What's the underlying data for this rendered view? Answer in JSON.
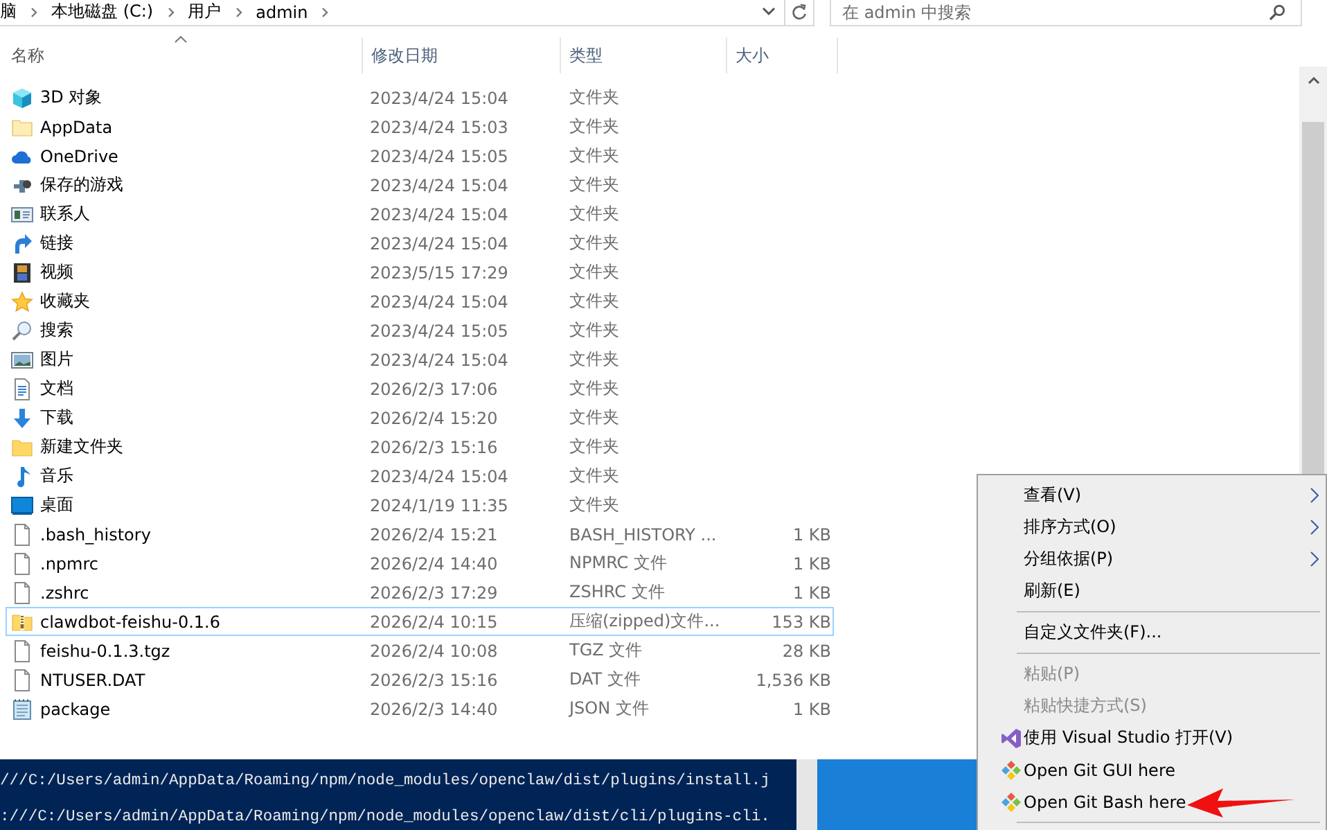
{
  "breadcrumb": [
    "脑",
    "本地磁盘 (C:)",
    "用户",
    "admin"
  ],
  "search": {
    "placeholder": "在 admin 中搜索"
  },
  "columns": [
    {
      "label": "名称",
      "sorted": true
    },
    {
      "label": "修改日期",
      "sorted": false
    },
    {
      "label": "类型",
      "sorted": false
    },
    {
      "label": "大小",
      "sorted": false
    }
  ],
  "files": [
    {
      "kind": "cube",
      "name": "3D 对象",
      "date": "2023/4/24 15:04",
      "type": "文件夹",
      "selected": false
    },
    {
      "kind": "folder-pale",
      "name": "AppData",
      "date": "2023/4/24 15:03",
      "type": "文件夹",
      "selected": false
    },
    {
      "kind": "cloud",
      "name": "OneDrive",
      "date": "2023/4/24 15:05",
      "type": "文件夹",
      "selected": false
    },
    {
      "kind": "games",
      "name": "保存的游戏",
      "date": "2023/4/24 15:04",
      "type": "文件夹",
      "selected": false
    },
    {
      "kind": "contact",
      "name": "联系人",
      "date": "2023/4/24 15:04",
      "type": "文件夹",
      "selected": false
    },
    {
      "kind": "link",
      "name": "链接",
      "date": "2023/4/24 15:04",
      "type": "文件夹",
      "selected": false
    },
    {
      "kind": "film",
      "name": "视频",
      "date": "2023/5/15 17:29",
      "type": "文件夹",
      "selected": false
    },
    {
      "kind": "star",
      "name": "收藏夹",
      "date": "2023/4/24 15:04",
      "type": "文件夹",
      "selected": false
    },
    {
      "kind": "search",
      "name": "搜索",
      "date": "2023/4/24 15:05",
      "type": "文件夹",
      "selected": false
    },
    {
      "kind": "image",
      "name": "图片",
      "date": "2023/4/24 15:04",
      "type": "文件夹",
      "selected": false
    },
    {
      "kind": "document",
      "name": "文档",
      "date": "2026/2/3 17:06",
      "type": "文件夹",
      "selected": false
    },
    {
      "kind": "download",
      "name": "下载",
      "date": "2026/2/4 15:20",
      "type": "文件夹",
      "selected": false
    },
    {
      "kind": "folder",
      "name": "新建文件夹",
      "date": "2026/2/3 15:16",
      "type": "文件夹",
      "selected": false
    },
    {
      "kind": "music",
      "name": "音乐",
      "date": "2023/4/24 15:04",
      "type": "文件夹",
      "selected": false
    },
    {
      "kind": "desktop",
      "name": "桌面",
      "date": "2024/1/19 11:35",
      "type": "文件夹",
      "selected": false
    },
    {
      "kind": "file",
      "name": ".bash_history",
      "date": "2026/2/4 15:21",
      "type": "BASH_HISTORY ...",
      "size": "1 KB",
      "selected": false
    },
    {
      "kind": "file",
      "name": ".npmrc",
      "date": "2026/2/4 14:40",
      "type": "NPMRC 文件",
      "size": "1 KB",
      "selected": false
    },
    {
      "kind": "file",
      "name": ".zshrc",
      "date": "2026/2/3 17:29",
      "type": "ZSHRC 文件",
      "size": "1 KB",
      "selected": false
    },
    {
      "kind": "zip",
      "name": "clawdbot-feishu-0.1.6",
      "date": "2026/2/4 10:15",
      "type": "压缩(zipped)文件...",
      "size": "153 KB",
      "selected": true
    },
    {
      "kind": "file",
      "name": "feishu-0.1.3.tgz",
      "date": "2026/2/4 10:08",
      "type": "TGZ 文件",
      "size": "28 KB",
      "selected": false
    },
    {
      "kind": "file",
      "name": "NTUSER.DAT",
      "date": "2026/2/3 15:16",
      "type": "DAT 文件",
      "size": "1,536 KB",
      "selected": false
    },
    {
      "kind": "notepad",
      "name": "package",
      "date": "2026/2/3 14:40",
      "type": "JSON 文件",
      "size": "1 KB",
      "selected": false
    }
  ],
  "terminal_lines": [
    "///C:/Users/admin/AppData/Roaming/npm/node_modules/openclaw/dist/plugins/install.j",
    ":///C:/Users/admin/AppData/Roaming/npm/node_modules/openclaw/dist/cli/plugins-cli."
  ],
  "context_menu": [
    {
      "kind": "submenu",
      "label": "查看(V)",
      "disabled": false
    },
    {
      "kind": "submenu",
      "label": "排序方式(O)",
      "disabled": false
    },
    {
      "kind": "submenu",
      "label": "分组依据(P)",
      "disabled": false
    },
    {
      "kind": "command",
      "label": "刷新(E)",
      "disabled": false
    },
    {
      "kind": "separator"
    },
    {
      "kind": "command",
      "label": "自定义文件夹(F)...",
      "disabled": false
    },
    {
      "kind": "separator"
    },
    {
      "kind": "command",
      "label": "粘贴(P)",
      "disabled": true
    },
    {
      "kind": "command",
      "label": "粘贴快捷方式(S)",
      "disabled": true
    },
    {
      "kind": "vs",
      "label": "使用 Visual Studio 打开(V)",
      "disabled": false
    },
    {
      "kind": "git",
      "label": "Open Git GUI here",
      "disabled": false
    },
    {
      "kind": "git",
      "label": "Open Git Bash here",
      "disabled": false,
      "annotated": true
    },
    {
      "kind": "separator"
    }
  ]
}
